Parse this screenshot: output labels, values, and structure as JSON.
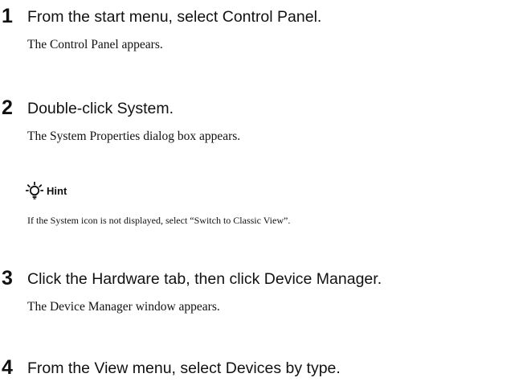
{
  "steps": [
    {
      "number": "1",
      "instruction": "From the start menu, select Control Panel.",
      "result": "The Control Panel appears."
    },
    {
      "number": "2",
      "instruction": "Double-click System.",
      "result": "The System Properties dialog box appears."
    },
    {
      "number": "3",
      "instruction": "Click the Hardware tab, then click Device Manager.",
      "result": "The Device Manager window appears."
    },
    {
      "number": "4",
      "instruction": "From the View menu, select Devices by type.",
      "result": ""
    }
  ],
  "hint": {
    "icon": "lightbulb-icon",
    "label": "Hint",
    "text": "If the System icon is not displayed, select “Switch to Classic View”."
  }
}
